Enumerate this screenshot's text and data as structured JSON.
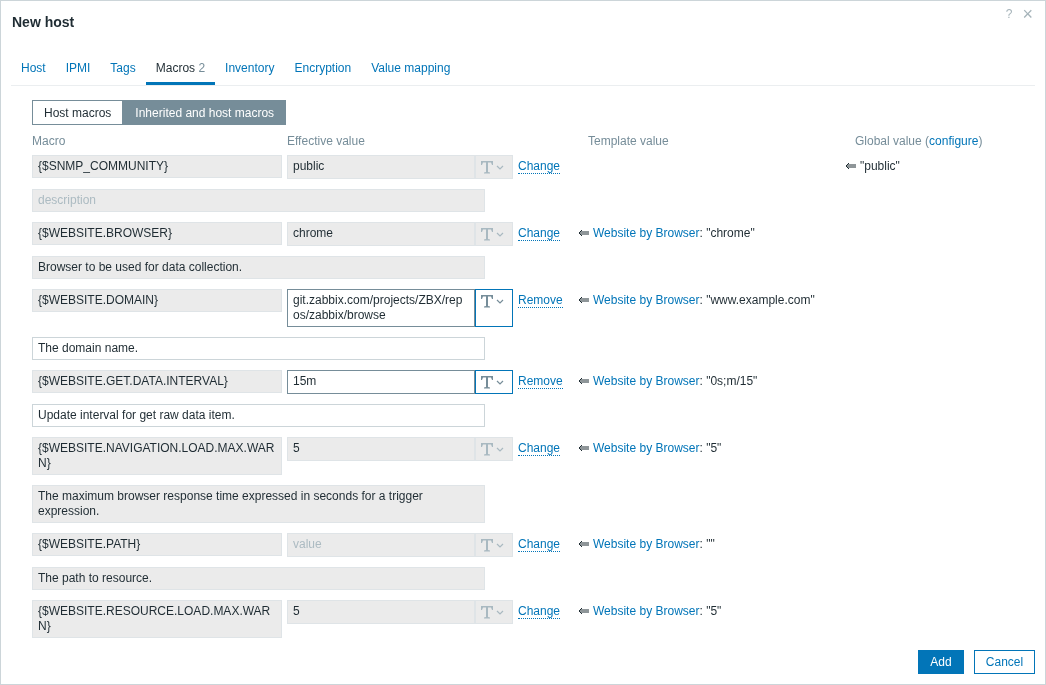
{
  "window": {
    "title": "New host",
    "help": "?",
    "close": "×"
  },
  "tabs": [
    {
      "label": "Host",
      "selected": false
    },
    {
      "label": "IPMI",
      "selected": false
    },
    {
      "label": "Tags",
      "selected": false
    },
    {
      "label": "Macros",
      "count": "2",
      "selected": true
    },
    {
      "label": "Inventory",
      "selected": false
    },
    {
      "label": "Encryption",
      "selected": false
    },
    {
      "label": "Value mapping",
      "selected": false
    }
  ],
  "macro_modes": [
    {
      "label": "Host macros",
      "selected": false
    },
    {
      "label": "Inherited and host macros",
      "selected": true
    }
  ],
  "columns": {
    "macro": "Macro",
    "effective": "Effective value",
    "template": "Template value",
    "global": "Global value (",
    "global_link": "configure",
    "global_end": ")"
  },
  "macros": [
    {
      "macro": "{$SNMP_COMMUNITY}",
      "value": "public",
      "editable": false,
      "action": "Change",
      "global": "\"public\"",
      "description": {
        "placeholder": "description"
      }
    },
    {
      "macro": "{$WEBSITE.BROWSER}",
      "value": "chrome",
      "editable": false,
      "action": "Change",
      "template": {
        "source": "Website by Browser",
        "value": ": \"chrome\""
      },
      "description": {
        "value": "Browser to be used for data collection."
      }
    },
    {
      "macro": "{$WEBSITE.DOMAIN}",
      "value": "git.zabbix.com/projects/ZBX/repos/zabbix/browse",
      "editable": true,
      "action": "Remove",
      "template": {
        "source": "Website by Browser",
        "value": ": \"www.example.com\""
      },
      "description": {
        "value": "The domain name."
      }
    },
    {
      "macro": "{$WEBSITE.GET.DATA.INTERVAL}",
      "value": "15m",
      "editable": true,
      "action": "Remove",
      "template": {
        "source": "Website by Browser",
        "value": ": \"0s;m/15\""
      },
      "description": {
        "value": "Update interval for get raw data item."
      }
    },
    {
      "macro": "{$WEBSITE.NAVIGATION.LOAD.MAX.WARN}",
      "value": "5",
      "editable": false,
      "action": "Change",
      "template": {
        "source": "Website by Browser",
        "value": ": \"5\""
      },
      "description": {
        "value": "The maximum browser response time expressed in seconds for a trigger expression."
      }
    },
    {
      "macro": "{$WEBSITE.PATH}",
      "placeholder": "value",
      "editable": false,
      "action": "Change",
      "template": {
        "source": "Website by Browser",
        "value": ": \"\""
      },
      "description": {
        "value": "The path to resource."
      }
    },
    {
      "macro": "{$WEBSITE.RESOURCE.LOAD.MAX.WARN}",
      "value": "5",
      "editable": false,
      "action": "Change",
      "template": {
        "source": "Website by Browser",
        "value": ": \"5\""
      }
    }
  ],
  "buttons": [
    {
      "label": "Add",
      "kind": "primary"
    },
    {
      "label": "Cancel",
      "kind": "secondary"
    }
  ]
}
